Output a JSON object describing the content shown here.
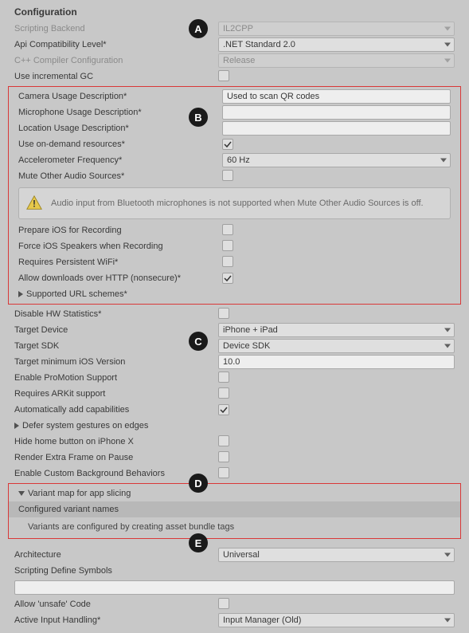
{
  "heading": "Configuration",
  "badges": {
    "A": "A",
    "B": "B",
    "C": "C",
    "D": "D",
    "E": "E"
  },
  "fields": {
    "scripting_backend": {
      "label": "Scripting Backend",
      "value": "IL2CPP"
    },
    "api_compat": {
      "label": "Api Compatibility Level*",
      "value": ".NET Standard 2.0"
    },
    "cpp_compiler": {
      "label": "C++ Compiler Configuration",
      "value": "Release"
    },
    "incremental_gc": {
      "label": "Use incremental GC",
      "checked": false
    },
    "camera_usage": {
      "label": "Camera Usage Description*",
      "value": "Used to scan QR codes"
    },
    "mic_usage": {
      "label": "Microphone Usage Description*",
      "value": ""
    },
    "loc_usage": {
      "label": "Location Usage Description*",
      "value": ""
    },
    "ondemand": {
      "label": "Use on-demand resources*",
      "checked": true
    },
    "accel_freq": {
      "label": "Accelerometer Frequency*",
      "value": "60 Hz"
    },
    "mute_other": {
      "label": "Mute Other Audio Sources*",
      "checked": false
    },
    "info_audio": "Audio input from Bluetooth microphones is not supported when Mute Other Audio Sources is off.",
    "prepare_ios": {
      "label": "Prepare iOS for Recording",
      "checked": false
    },
    "force_speakers": {
      "label": "Force iOS Speakers when Recording",
      "checked": false
    },
    "persistent_wifi": {
      "label": "Requires Persistent WiFi*",
      "checked": false
    },
    "allow_http": {
      "label": "Allow downloads over HTTP (nonsecure)*",
      "checked": true
    },
    "supported_url": {
      "label": "Supported URL schemes*"
    },
    "disable_hw": {
      "label": "Disable HW Statistics*",
      "checked": false
    },
    "target_device": {
      "label": "Target Device",
      "value": "iPhone + iPad"
    },
    "target_sdk": {
      "label": "Target SDK",
      "value": "Device SDK"
    },
    "target_min_ios": {
      "label": "Target minimum iOS Version",
      "value": "10.0"
    },
    "promotion": {
      "label": "Enable ProMotion Support",
      "checked": false
    },
    "arkit": {
      "label": "Requires ARKit support",
      "checked": false
    },
    "auto_caps": {
      "label": "Automatically add capabilities",
      "checked": true
    },
    "defer_gestures": {
      "label": "Defer system gestures on edges"
    },
    "hide_home": {
      "label": "Hide home button on iPhone X",
      "checked": false
    },
    "render_extra": {
      "label": "Render Extra Frame on Pause",
      "checked": false
    },
    "custom_bg": {
      "label": "Enable Custom Background Behaviors",
      "checked": false
    },
    "variant_map": {
      "label": "Variant map for app slicing"
    },
    "configured_variants": "Configured variant names",
    "variants_note": "Variants are configured by creating asset bundle tags",
    "architecture": {
      "label": "Architecture",
      "value": "Universal"
    },
    "scripting_define": {
      "label": "Scripting Define Symbols",
      "value": ""
    },
    "allow_unsafe": {
      "label": "Allow 'unsafe' Code",
      "checked": false
    },
    "active_input": {
      "label": "Active Input Handling*",
      "value": "Input Manager (Old)"
    }
  }
}
